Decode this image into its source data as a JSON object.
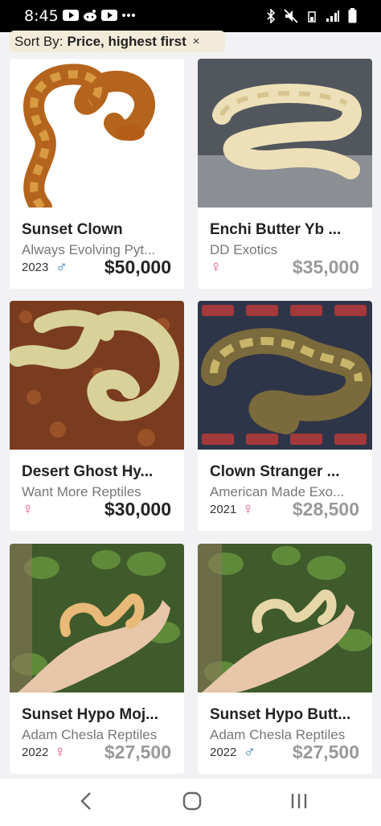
{
  "status": {
    "time": "8:45"
  },
  "sort": {
    "label": "Sort By:",
    "value": "Price, highest first",
    "clear": "×"
  },
  "colors": {
    "male": "#2979c6",
    "female": "#ea4f86",
    "sort_bg": "#f3ebd9"
  },
  "listings": [
    {
      "title": "Sunset Clown",
      "seller": "Always Evolving Pyt...",
      "year": "2023",
      "sex": "male",
      "sex_symbol": "♂",
      "price": "$50,000"
    },
    {
      "title": "Enchi Butter Yb ...",
      "seller": "DD Exotics",
      "year": "",
      "sex": "female",
      "sex_symbol": "♀",
      "price": "$35,000"
    },
    {
      "title": "Desert Ghost Hy...",
      "seller": "Want More Reptiles",
      "year": "",
      "sex": "female",
      "sex_symbol": "♀",
      "price": "$30,000"
    },
    {
      "title": "Clown Stranger ...",
      "seller": "American Made Exo...",
      "year": "2021",
      "sex": "female",
      "sex_symbol": "♀",
      "price": "$28,500"
    },
    {
      "title": "Sunset Hypo Moj...",
      "seller": "Adam Chesla Reptiles",
      "year": "2022",
      "sex": "female",
      "sex_symbol": "♀",
      "price": "$27,500"
    },
    {
      "title": "Sunset Hypo Butt...",
      "seller": "Adam Chesla Reptiles",
      "year": "2022",
      "sex": "male",
      "sex_symbol": "♂",
      "price": "$27,500"
    }
  ]
}
